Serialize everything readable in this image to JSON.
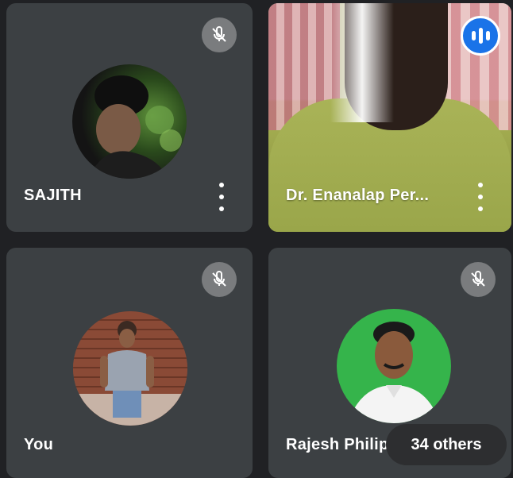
{
  "tiles": [
    {
      "name": "SAJITH",
      "muted": true,
      "avatar_icon": "profile-photo"
    },
    {
      "name": "Dr. Enanalap Per...",
      "speaking": true,
      "speaking_icon": "audio-level-icon"
    },
    {
      "name": "You",
      "muted": true,
      "avatar_icon": "profile-photo"
    },
    {
      "name": "Rajesh Philip",
      "muted": true,
      "avatar_icon": "profile-photo"
    }
  ],
  "others_chip": "34 others",
  "colors": {
    "background": "#202124",
    "tile": "#3c4043",
    "speaking_accent": "#1a73e8",
    "mute_badge": "#7a7c7e"
  }
}
